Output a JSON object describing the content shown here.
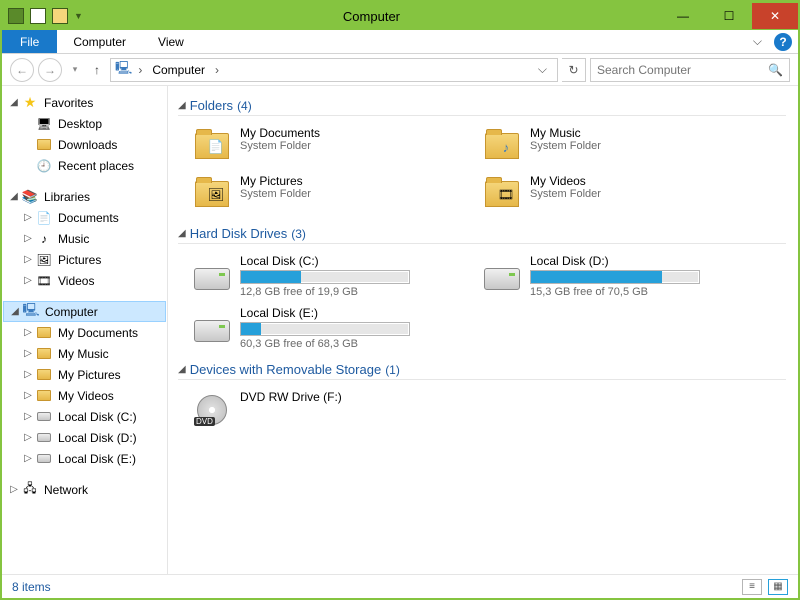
{
  "window": {
    "title": "Computer"
  },
  "ribbon": {
    "file": "File",
    "tabs": [
      "Computer",
      "View"
    ]
  },
  "breadcrumb": {
    "root": "Computer"
  },
  "search": {
    "placeholder": "Search Computer"
  },
  "sidebar": {
    "favorites": {
      "label": "Favorites",
      "items": [
        "Desktop",
        "Downloads",
        "Recent places"
      ]
    },
    "libraries": {
      "label": "Libraries",
      "items": [
        "Documents",
        "Music",
        "Pictures",
        "Videos"
      ]
    },
    "computer": {
      "label": "Computer",
      "items": [
        "My Documents",
        "My Music",
        "My Pictures",
        "My Videos",
        "Local Disk (C:)",
        "Local Disk (D:)",
        "Local Disk (E:)"
      ]
    },
    "network": {
      "label": "Network"
    }
  },
  "groups": [
    {
      "name": "Folders",
      "count": "(4)",
      "items": [
        {
          "name": "My Documents",
          "sub": "System Folder",
          "icon": "docs"
        },
        {
          "name": "My Music",
          "sub": "System Folder",
          "icon": "music"
        },
        {
          "name": "My Pictures",
          "sub": "System Folder",
          "icon": "pics"
        },
        {
          "name": "My Videos",
          "sub": "System Folder",
          "icon": "video"
        }
      ]
    },
    {
      "name": "Hard Disk Drives",
      "count": "(3)",
      "items": [
        {
          "name": "Local Disk (C:)",
          "sub": "12,8 GB free of 19,9 GB",
          "fill": 36
        },
        {
          "name": "Local Disk (D:)",
          "sub": "15,3 GB free of 70,5 GB",
          "fill": 78
        },
        {
          "name": "Local Disk (E:)",
          "sub": "60,3 GB free of 68,3 GB",
          "fill": 12
        }
      ]
    },
    {
      "name": "Devices with Removable Storage",
      "count": "(1)",
      "items": [
        {
          "name": "DVD RW Drive (F:)",
          "icon": "dvd"
        }
      ]
    }
  ],
  "statusbar": {
    "count": "8 items"
  }
}
